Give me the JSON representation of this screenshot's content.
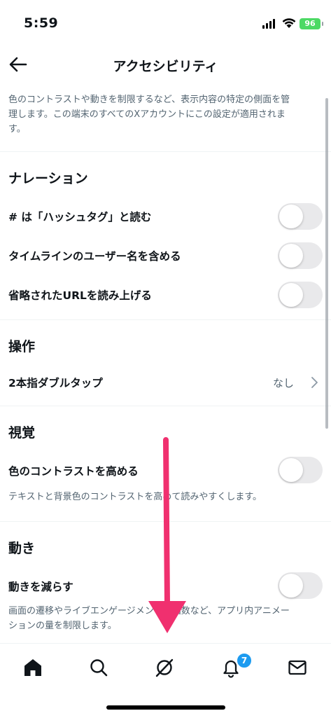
{
  "status_bar": {
    "time": "5:59",
    "battery": "96"
  },
  "header": {
    "title": "アクセシビリティ",
    "back_icon": "arrow-left-icon"
  },
  "description": {
    "line1": "色のコントラストや動きを制限するなど、表示内容の特定の側面を管",
    "line2": "理します。この端末のすべてのXアカウントにこの設定が適用されま",
    "line3": "す。"
  },
  "narration": {
    "title": "ナレーション",
    "items": [
      {
        "label": "# は「ハッシュタグ」と読む",
        "enabled": false
      },
      {
        "label": "タイムラインのユーザー名を含める",
        "enabled": false
      },
      {
        "label": "省略されたURLを読み上げる",
        "enabled": false
      }
    ]
  },
  "operation": {
    "title": "操作",
    "item": {
      "label": "2本指ダブルタップ",
      "value": "なし"
    }
  },
  "visual": {
    "title": "視覚",
    "item": {
      "label": "色のコントラストを高める",
      "enabled": false,
      "desc": "テキストと背景色のコントラストを高めて読みやすくします。"
    }
  },
  "motion": {
    "title": "動き",
    "item": {
      "label": "動きを減らす",
      "enabled": false,
      "desc_line1": "画面の遷移やライブエンゲージメントの回数など、アプリ内アニメー",
      "desc_line2": "ションの量を制限します。"
    }
  },
  "nav": {
    "items": [
      "home-icon",
      "search-icon",
      "grok-icon",
      "bell-icon",
      "mail-icon"
    ],
    "notification_badge": "7"
  },
  "colors": {
    "accent": "#1d9bf0",
    "annotation_arrow": "#f0306f",
    "toggle_off": "#e9e9eb"
  }
}
